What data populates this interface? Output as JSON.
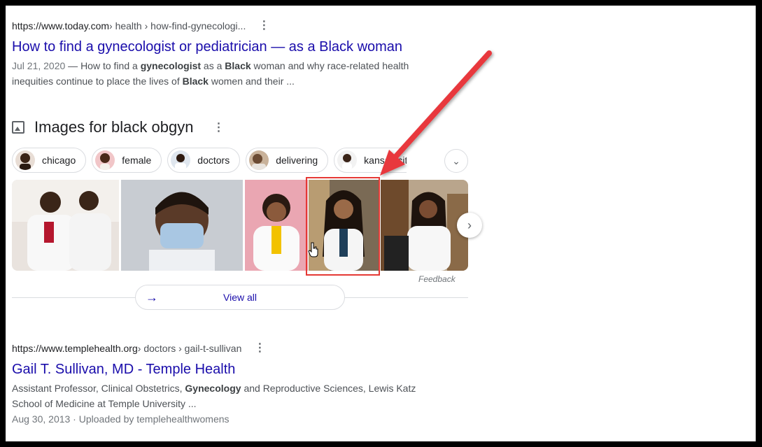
{
  "result1": {
    "domain": "https://www.today.com",
    "path": " › health › how-find-gynecologi...",
    "title": "How to find a gynecologist or pediatrician — as a Black woman",
    "date": "Jul 21, 2020",
    "snippet_parts": [
      " — How to find a ",
      "gynecologist",
      " as a ",
      "Black",
      " woman and why race-related health inequities continue to place the lives of ",
      "Black",
      " women and their ..."
    ]
  },
  "images": {
    "heading": "Images for black obgyn",
    "chips": [
      {
        "label": "chicago"
      },
      {
        "label": "female"
      },
      {
        "label": "doctors"
      },
      {
        "label": "delivering"
      },
      {
        "label": "kansas city"
      }
    ],
    "feedback": "Feedback",
    "view_all": "View all"
  },
  "result2": {
    "domain": "https://www.templehealth.org",
    "path": " › doctors › gail-t-sullivan",
    "title": "Gail T. Sullivan, MD - Temple Health",
    "snippet_parts": [
      "Assistant Professor, Clinical Obstetrics, ",
      "Gynecology",
      " and Reproductive Sciences, Lewis Katz School of Medicine at Temple University ..."
    ],
    "meta": "Aug 30, 2013 · Uploaded by templehealthwomens"
  },
  "icons": {
    "menu": "more-vert-icon",
    "image": "image-icon",
    "chevron_down": "chevron-down-icon",
    "chevron_right": "chevron-right-icon",
    "arrow_right": "arrow-right-icon",
    "cursor": "hand-cursor-icon"
  },
  "colors": {
    "link": "#1a0dab",
    "annotation": "#e53935"
  }
}
